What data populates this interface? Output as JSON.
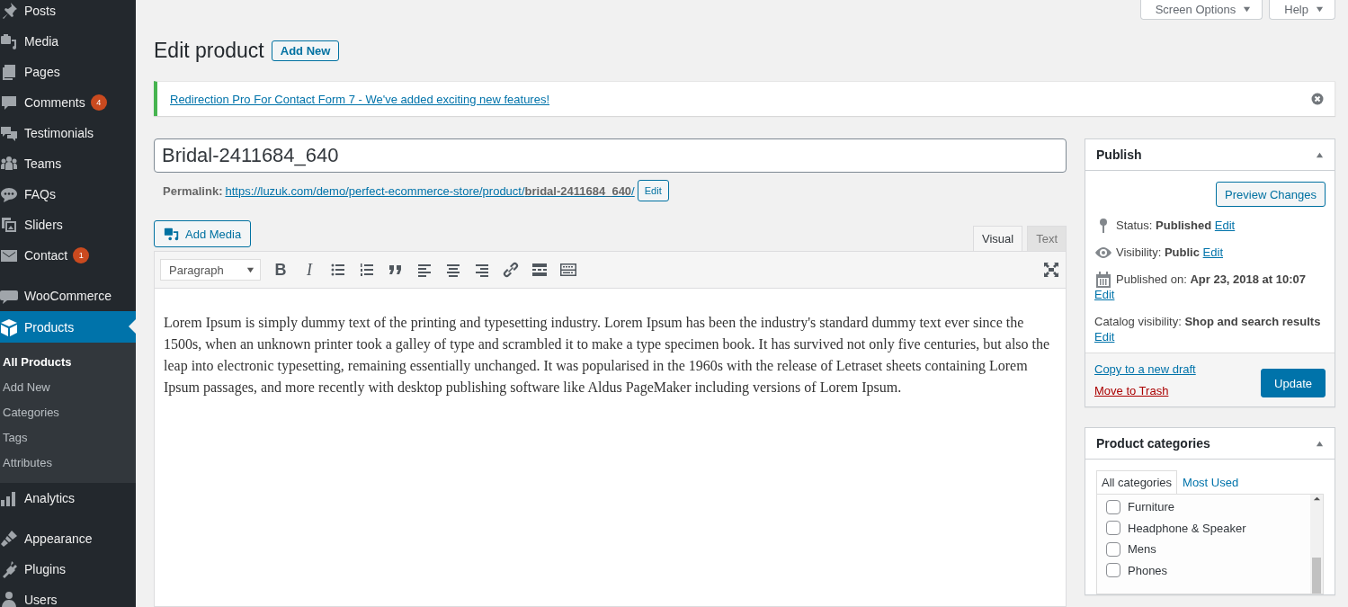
{
  "sidebar": {
    "groups": [
      [
        {
          "label": "Posts",
          "selected": false
        },
        {
          "label": "Media",
          "selected": false
        },
        {
          "label": "Pages",
          "selected": false
        },
        {
          "label": "Comments",
          "selected": false,
          "badge": "4"
        },
        {
          "label": "Testimonials",
          "selected": false
        },
        {
          "label": "Teams",
          "selected": false
        },
        {
          "label": "FAQs",
          "selected": false
        },
        {
          "label": "Sliders",
          "selected": false
        },
        {
          "label": "Contact",
          "selected": false,
          "badge": "1"
        }
      ],
      [
        {
          "label": "WooCommerce",
          "selected": false
        },
        {
          "label": "Products",
          "selected": true,
          "children": [
            {
              "label": "All Products",
              "selected": true
            },
            {
              "label": "Add New",
              "selected": false
            },
            {
              "label": "Categories",
              "selected": false
            },
            {
              "label": "Tags",
              "selected": false
            },
            {
              "label": "Attributes",
              "selected": false
            }
          ]
        },
        {
          "label": "Analytics",
          "selected": false
        }
      ],
      [
        {
          "label": "Appearance",
          "selected": false
        },
        {
          "label": "Plugins",
          "selected": false
        },
        {
          "label": "Users",
          "selected": false
        }
      ]
    ]
  },
  "header_buttons": [
    {
      "label": "Screen Options"
    },
    {
      "label": "Help"
    }
  ],
  "page_title": "Edit product",
  "add_new_button": "Add New",
  "notice": {
    "link": "Redirection Pro For Contact Form 7 - We've added exciting new features!"
  },
  "post_title": "Bridal-2411684_640",
  "permalink": {
    "label": "Permalink:",
    "url": "https://luzuk.com/demo/perfect-ecommerce-store/product/**bridal-2411684_640**/",
    "edit_button": "Edit"
  },
  "add_media_button": "Add Media",
  "editor_tabs": [
    {
      "label": "Visual",
      "selected": true
    },
    {
      "label": "Text",
      "selected": false
    }
  ],
  "format_select": "Paragraph",
  "toolbar": [
    {
      "kind": "bold",
      "glyph": "B"
    },
    {
      "kind": "italic",
      "glyph": "I"
    },
    {
      "kind": "bullet-list"
    },
    {
      "kind": "numbered-list"
    },
    {
      "kind": "quote"
    },
    {
      "kind": "align-left"
    },
    {
      "kind": "align-center"
    },
    {
      "kind": "align-right"
    },
    {
      "kind": "link"
    },
    {
      "kind": "read-more"
    },
    {
      "kind": "toolbar-toggle"
    }
  ],
  "content": "Lorem Ipsum is simply dummy text of the printing and typesetting industry. Lorem Ipsum has been the industry's standard dummy text ever since the 1500s, when an unknown printer took a galley of type and scrambled it to make a type specimen book. It has survived not only five centuries, but also the leap into electronic typesetting, remaining essentially unchanged. It was popularised in the 1960s with the release of Letraset sheets containing Lorem Ipsum passages, and more recently with desktop publishing software like Aldus PageMaker including versions of Lorem Ipsum.",
  "publish": {
    "title": "Publish",
    "preview_button": "Preview Changes",
    "fields": [
      {
        "kind": "status",
        "text": "Status: **Published**",
        "link": "Edit",
        "link_on_new_line": false
      },
      {
        "kind": "visibility",
        "text": "Visibility: **Public**",
        "link": "Edit",
        "link_on_new_line": false
      },
      {
        "kind": "date",
        "text": "Published on: **Apr 23, 2018 at 10:07**",
        "link": "Edit",
        "link_on_new_line": true
      },
      {
        "kind": "plain",
        "text": "Catalog visibility: **Shop and search results**",
        "link": "Edit",
        "link_on_new_line": true
      }
    ],
    "copy_link": "Copy to a new draft",
    "trash_link": "Move to Trash",
    "update_button": "Update"
  },
  "categories": {
    "title": "Product categories",
    "tabs": [
      {
        "label": "All categories",
        "selected": true
      },
      {
        "label": "Most Used",
        "selected": false
      }
    ],
    "items": [
      {
        "label": "Furniture",
        "checked": false
      },
      {
        "label": "Headphone & Speaker",
        "checked": false
      },
      {
        "label": "Mens",
        "checked": false
      },
      {
        "label": "Phones",
        "checked": false
      }
    ]
  }
}
